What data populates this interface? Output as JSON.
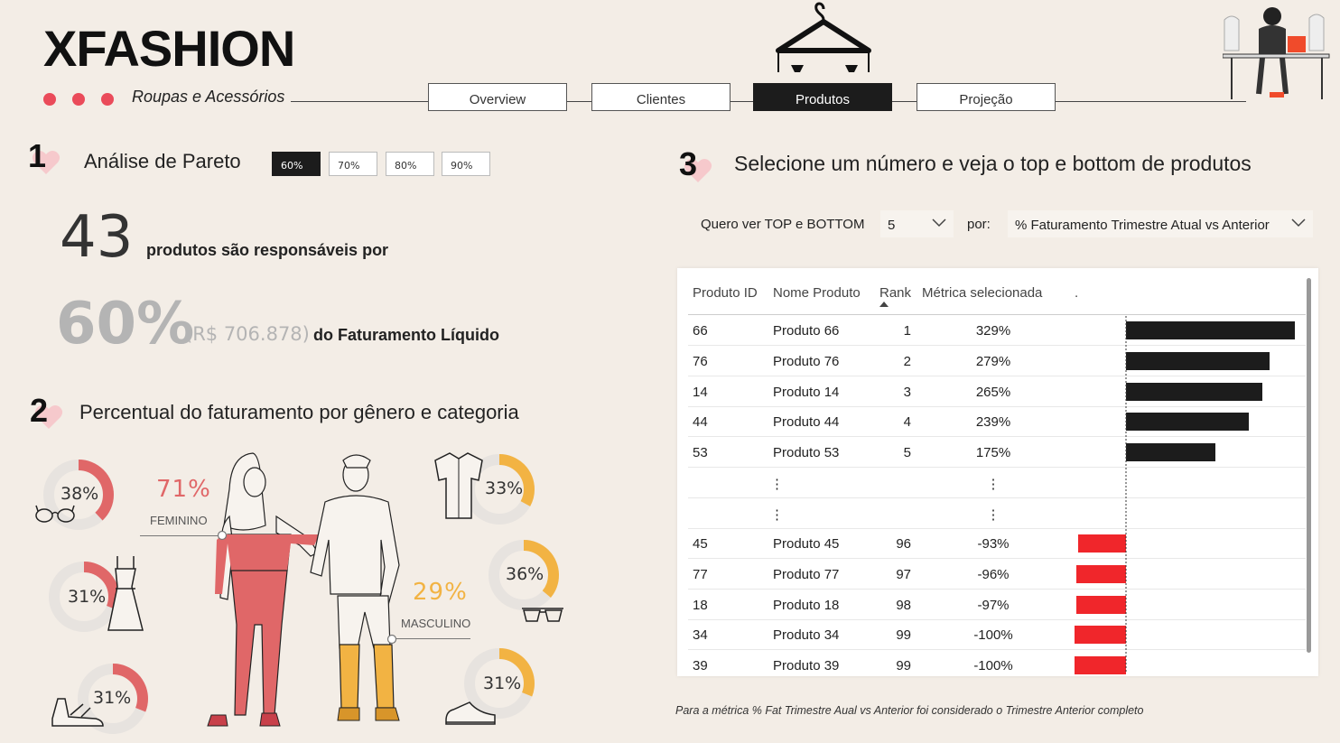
{
  "brand": {
    "title": "XFASHION",
    "tagline": "Roupas e Acessórios"
  },
  "nav": {
    "tabs": [
      {
        "label": "Overview",
        "active": false
      },
      {
        "label": "Clientes",
        "active": false
      },
      {
        "label": "Produtos",
        "active": true
      },
      {
        "label": "Projeção",
        "active": false
      }
    ]
  },
  "section1": {
    "number": "1",
    "title": "Análise de Pareto",
    "pareto_buttons": [
      "60%",
      "70%",
      "80%",
      "90%"
    ],
    "selected": "60%",
    "product_count": "43",
    "product_text": "produtos são responsáveis por",
    "share": "60%",
    "revenue": "(R$ 706.878)",
    "revenue_text": "do Faturamento Líquido"
  },
  "section2": {
    "number": "2",
    "title": "Percentual do faturamento por gênero e categoria",
    "feminino": {
      "label": "FEMININO",
      "pct": "71%",
      "value": 0.71
    },
    "masculino": {
      "label": "MASCULINO",
      "pct": "29%",
      "value": 0.29
    },
    "female_categories": [
      {
        "pct": "38%",
        "value": 0.38,
        "icon": "sunglasses-icon"
      },
      {
        "pct": "31%",
        "value": 0.31,
        "icon": "dress-icon"
      },
      {
        "pct": "31%",
        "value": 0.31,
        "icon": "sandal-icon"
      }
    ],
    "male_categories": [
      {
        "pct": "33%",
        "value": 0.33,
        "icon": "shirt-icon"
      },
      {
        "pct": "36%",
        "value": 0.36,
        "icon": "sunglasses-icon"
      },
      {
        "pct": "31%",
        "value": 0.31,
        "icon": "sneaker-icon"
      }
    ],
    "colors": {
      "female": "#e06768",
      "male": "#f2b343",
      "track": "#e7e3df"
    }
  },
  "section3": {
    "number": "3",
    "title": "Selecione um número e veja o top e bottom de produtos",
    "filter_label": "Quero ver TOP e BOTTOM",
    "n_value": "5",
    "by_label": "por:",
    "metric_value": "% Faturamento Trimestre Atual vs Anterior",
    "table": {
      "headers": [
        "Produto ID",
        "Nome Produto",
        "Rank",
        "Métrica selecionada",
        "."
      ],
      "top_rows": [
        {
          "id": "66",
          "name": "Produto 66",
          "rank": "1",
          "metric": "329%",
          "value": 329
        },
        {
          "id": "76",
          "name": "Produto 76",
          "rank": "2",
          "metric": "279%",
          "value": 279
        },
        {
          "id": "14",
          "name": "Produto 14",
          "rank": "3",
          "metric": "265%",
          "value": 265
        },
        {
          "id": "44",
          "name": "Produto 44",
          "rank": "4",
          "metric": "239%",
          "value": 239
        },
        {
          "id": "53",
          "name": "Produto 53",
          "rank": "5",
          "metric": "175%",
          "value": 175
        }
      ],
      "ellipsis": "⋮",
      "bottom_rows": [
        {
          "id": "45",
          "name": "Produto 45",
          "rank": "96",
          "metric": "-93%",
          "value": -93
        },
        {
          "id": "77",
          "name": "Produto 77",
          "rank": "97",
          "metric": "-96%",
          "value": -96
        },
        {
          "id": "18",
          "name": "Produto 18",
          "rank": "98",
          "metric": "-97%",
          "value": -97
        },
        {
          "id": "34",
          "name": "Produto 34",
          "rank": "99",
          "metric": "-100%",
          "value": -100
        },
        {
          "id": "39",
          "name": "Produto 39",
          "rank": "99",
          "metric": "-100%",
          "value": -100
        }
      ],
      "colors": {
        "positive": "#1c1c1c",
        "negative": "#f0262b"
      }
    },
    "footnote": "Para a métrica % Fat Trimestre Aual vs Anterior foi considerado o Trimestre Anterior completo"
  }
}
